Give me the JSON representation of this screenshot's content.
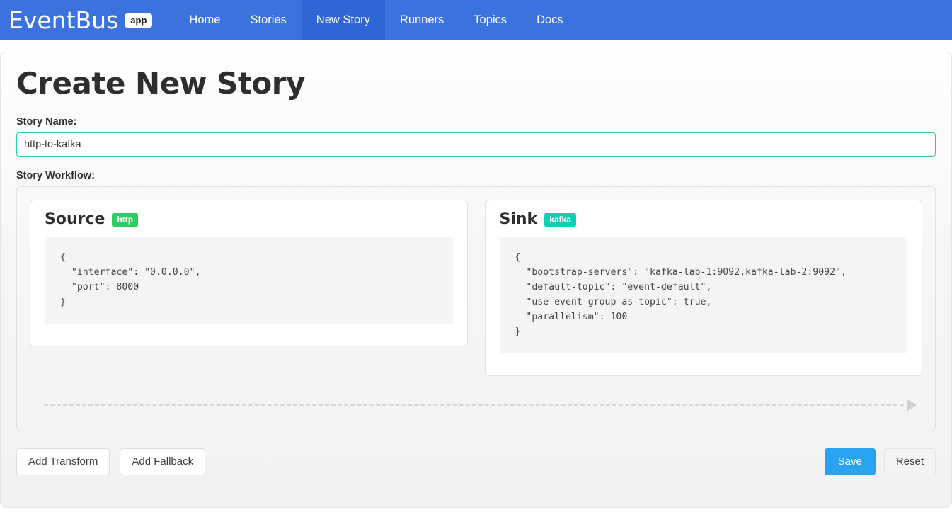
{
  "navbar": {
    "brand_name": "EventBus",
    "brand_badge": "app",
    "items": [
      {
        "label": "Home",
        "active": false
      },
      {
        "label": "Stories",
        "active": false
      },
      {
        "label": "New Story",
        "active": true
      },
      {
        "label": "Runners",
        "active": false
      },
      {
        "label": "Topics",
        "active": false
      },
      {
        "label": "Docs",
        "active": false
      }
    ],
    "bg_color": "#3b72dd",
    "active_bg_color": "#2f66d6"
  },
  "page": {
    "title": "Create New Story"
  },
  "form": {
    "story_name_label": "Story Name:",
    "story_name_value": "http-to-kafka",
    "story_name_placeholder": "Story Name",
    "story_workflow_label": "Story Workflow:",
    "input_border_color": "#1dd0a5"
  },
  "workflow": {
    "nodes": [
      {
        "title": "Source",
        "badge": "http",
        "badge_color": "#2ecc62",
        "config": "{\n  \"interface\": \"0.0.0.0\",\n  \"port\": 8000\n}"
      },
      {
        "title": "Sink",
        "badge": "kafka",
        "badge_color": "#0fd0ae",
        "config": "{\n  \"bootstrap-servers\": \"kafka-lab-1:9092,kafka-lab-2:9092\",\n  \"default-topic\": \"event-default\",\n  \"use-event-group-as-topic\": true,\n  \"parallelism\": 100\n}"
      }
    ],
    "connector_color": "#d6d6d6"
  },
  "actions": {
    "add_transform_label": "Add Transform",
    "add_fallback_label": "Add Fallback",
    "save_label": "Save",
    "reset_label": "Reset",
    "save_color": "#29a3f0"
  }
}
